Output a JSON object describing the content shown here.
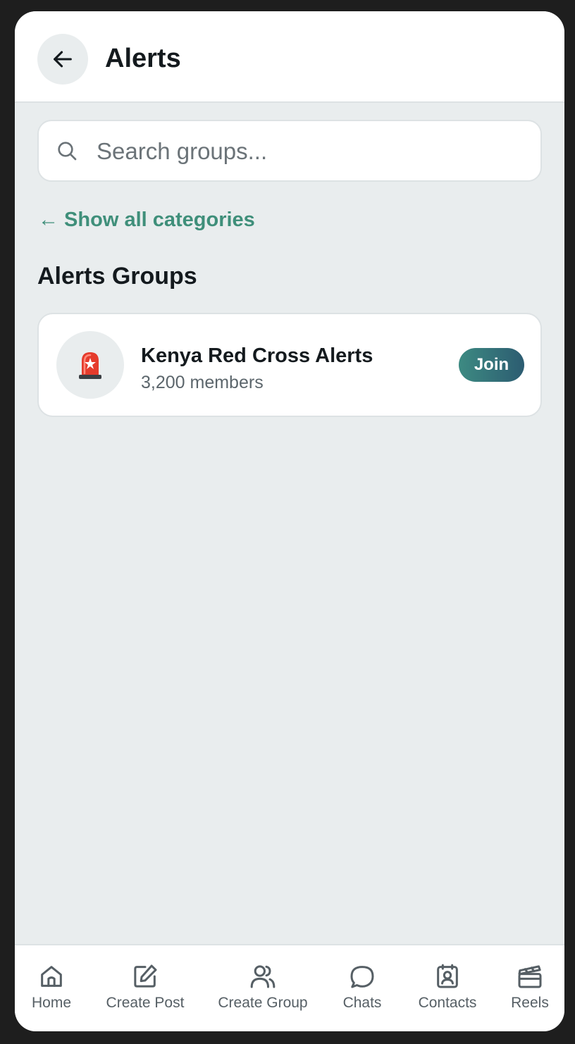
{
  "header": {
    "title": "Alerts",
    "back_icon": "arrow-left-icon"
  },
  "search": {
    "placeholder": "Search groups...",
    "value": "",
    "icon": "search-icon"
  },
  "nav_link": {
    "label": "← Show all categories"
  },
  "section": {
    "title": "Alerts Groups"
  },
  "groups": [
    {
      "name": "Kenya Red Cross Alerts",
      "members": "3,200 members",
      "emoji": "🚨",
      "action_label": "Join"
    }
  ],
  "bottom_nav": {
    "items": [
      {
        "label": "Home",
        "icon": "home-icon"
      },
      {
        "label": "Create Post",
        "icon": "edit-icon"
      },
      {
        "label": "Create Group",
        "icon": "users-icon"
      },
      {
        "label": "Chats",
        "icon": "chat-bubble-icon"
      },
      {
        "label": "Contacts",
        "icon": "contact-book-icon"
      },
      {
        "label": "Reels",
        "icon": "clapperboard-icon"
      }
    ]
  },
  "colors": {
    "accent": "#3f8f7a",
    "join_gradient_start": "#3d8a82",
    "join_gradient_end": "#2c5c71",
    "background": "#e9edee",
    "surface": "#ffffff"
  }
}
